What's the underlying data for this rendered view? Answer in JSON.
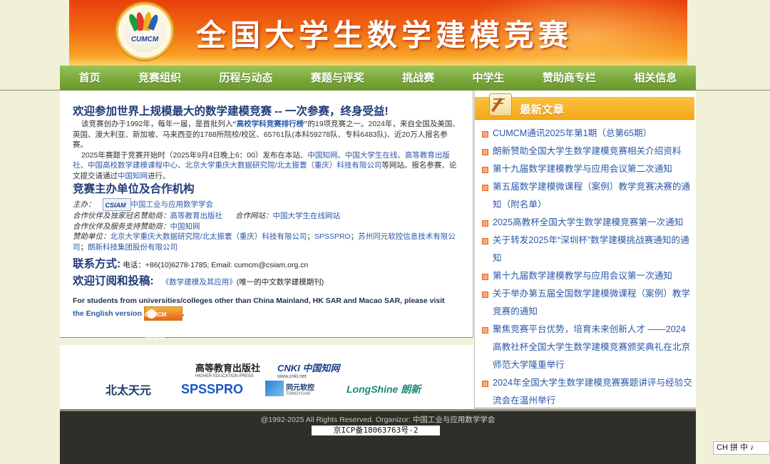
{
  "header": {
    "logo_text": "CUMCM",
    "site_title": "全国大学生数学建模竞赛"
  },
  "nav": [
    {
      "label": "首页"
    },
    {
      "label": "竞赛组织"
    },
    {
      "label": "历程与动态"
    },
    {
      "label": "赛题与评奖"
    },
    {
      "label": "挑战赛"
    },
    {
      "label": "中学生"
    },
    {
      "label": "赞助商专栏"
    },
    {
      "label": "相关信息"
    }
  ],
  "welcome": {
    "heading": "欢迎参加世界上规模最大的数学建模竞赛 -- 一次参赛，终身受益!",
    "p1_a": "该竞赛创办于1992年，每年一届，是首批列入",
    "p1_link": "“高校学科竞赛排行榜”",
    "p1_b": "的19项竞赛之一。2024年，来自全国及美国、英国、澳大利亚、新加坡、马来西亚的1788所院校/校区、65761队(本科59278队、专科6483队)、近20万人报名参赛。",
    "p2_a": "2025年赛题于竞赛开始时（2025年9月4日晚上6：00）发布在本站、",
    "p2_links": [
      "中国知网",
      "中国大学生在线",
      "高等教育出版社",
      "中国高校数学建模课程中心",
      "北京大学重庆大数据研究院/北太振寰（重庆）科技有限公司"
    ],
    "p2_b": "等网站。报名参赛、论文提交请通过",
    "p2_link_last": "中国知网",
    "p2_c": "进行。"
  },
  "organizers": {
    "heading": "竞赛主办单位及合作机构",
    "host_label": "主办：",
    "host_name": "中国工业与应用数学学会",
    "csiam_logo_text": "CSIAM",
    "partner_label": "合作伙伴及独家冠名赞助商：",
    "partner_name": "高等教育出版社",
    "coop_site_label": "合作网站：",
    "coop_site_name": "中国大学生在线网站",
    "service_label": "合作伙伴及服务支持赞助商：",
    "service_name": "中国知网",
    "sponsor_label": "赞助单位：",
    "sponsor_names": [
      "北京大学重庆大数据研究院/北太振寰（重庆）科技有限公司",
      "SPSSPRO",
      "苏州同元软控信息技术有限公司",
      "朗新科技集团股份有限公司"
    ]
  },
  "contact": {
    "heading": "联系方式:",
    "text": "电话：+86(10)6278-1785; Email: cumcm@csiam.org.cn"
  },
  "subscribe": {
    "heading": "欢迎订阅和投稿:",
    "journal": "《数学建模及其应用》",
    "note": "(唯一的中文数学建模期刊)"
  },
  "english": {
    "text": "For students from universities/colleges other than China Mainland, HK SAR and Macao SAR, please visit",
    "link": "the English version",
    "badge": "CUMCM English Version"
  },
  "sponsor_logos": [
    {
      "name": "高等教育出版社",
      "sub": "HIGHER EDUCATION PRESS"
    },
    {
      "name": "CNKI 中国知网",
      "sub": "www.cnki.net"
    },
    {
      "name": "北太天元"
    },
    {
      "name": "SPSSPRO"
    },
    {
      "name": "同元软控",
      "sub": "TONGYUAN"
    },
    {
      "name": "LongShine 朗新"
    }
  ],
  "sidebar": {
    "title": "最新文章",
    "articles": [
      "CUMCM通讯2025年第1期（总第65期）",
      "朗新赞助全国大学生数学建模竞赛相关介绍资料",
      "第十九届数学建模教学与应用会议第二次通知",
      "第五届数学建模微课程（案例）教学竞赛决赛的通知（附名单）",
      "2025高教杯全国大学生数学建模竞赛第一次通知",
      "关于转发2025年“深圳杯”数学建模挑战赛通知的通知",
      "第十九届数学建模教学与应用会议第一次通知",
      "关于举办第五届全国数学建模微课程（案例）教学竞赛的通知",
      "聚焦竞赛平台优势，培育未来创新人才 ——2024高教社杯全国大学生数学建模竞赛颁奖典礼在北京师范大学隆重举行",
      "2024年全国大学生数学建模竞赛赛题讲评与经验交流会在温州举行"
    ]
  },
  "footer": {
    "copyright": "@1992-2025 All Rights Reserved.   Organizor: ",
    "organizer_link": "中国工业与应用数学学会",
    "icp": "京ICP备18063763号-2"
  },
  "ime": {
    "text": "CH 拼 中 ♪"
  },
  "colors": {
    "nav_green": "#7aa83a",
    "banner_orange": "#f26a12",
    "heading_blue": "#1f3b7a",
    "link_blue": "#2a59a8",
    "sidebar_header": "#f5a81b",
    "footer_bg": "#2e2e2a"
  }
}
